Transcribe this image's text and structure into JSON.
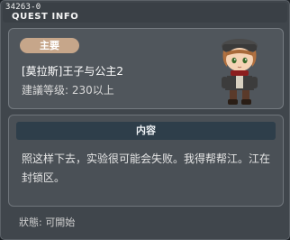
{
  "window": {
    "id": "34263-0",
    "title": "QUEST INFO"
  },
  "quest": {
    "badge": "主要",
    "name": "[莫拉斯]王子与公主2",
    "level": "建議等级: 230以上"
  },
  "content": {
    "header": "内容",
    "text": "照这样下去，实验很可能会失败。我得帮帮江。江在封锁区。"
  },
  "status": "狀態: 可開始"
}
